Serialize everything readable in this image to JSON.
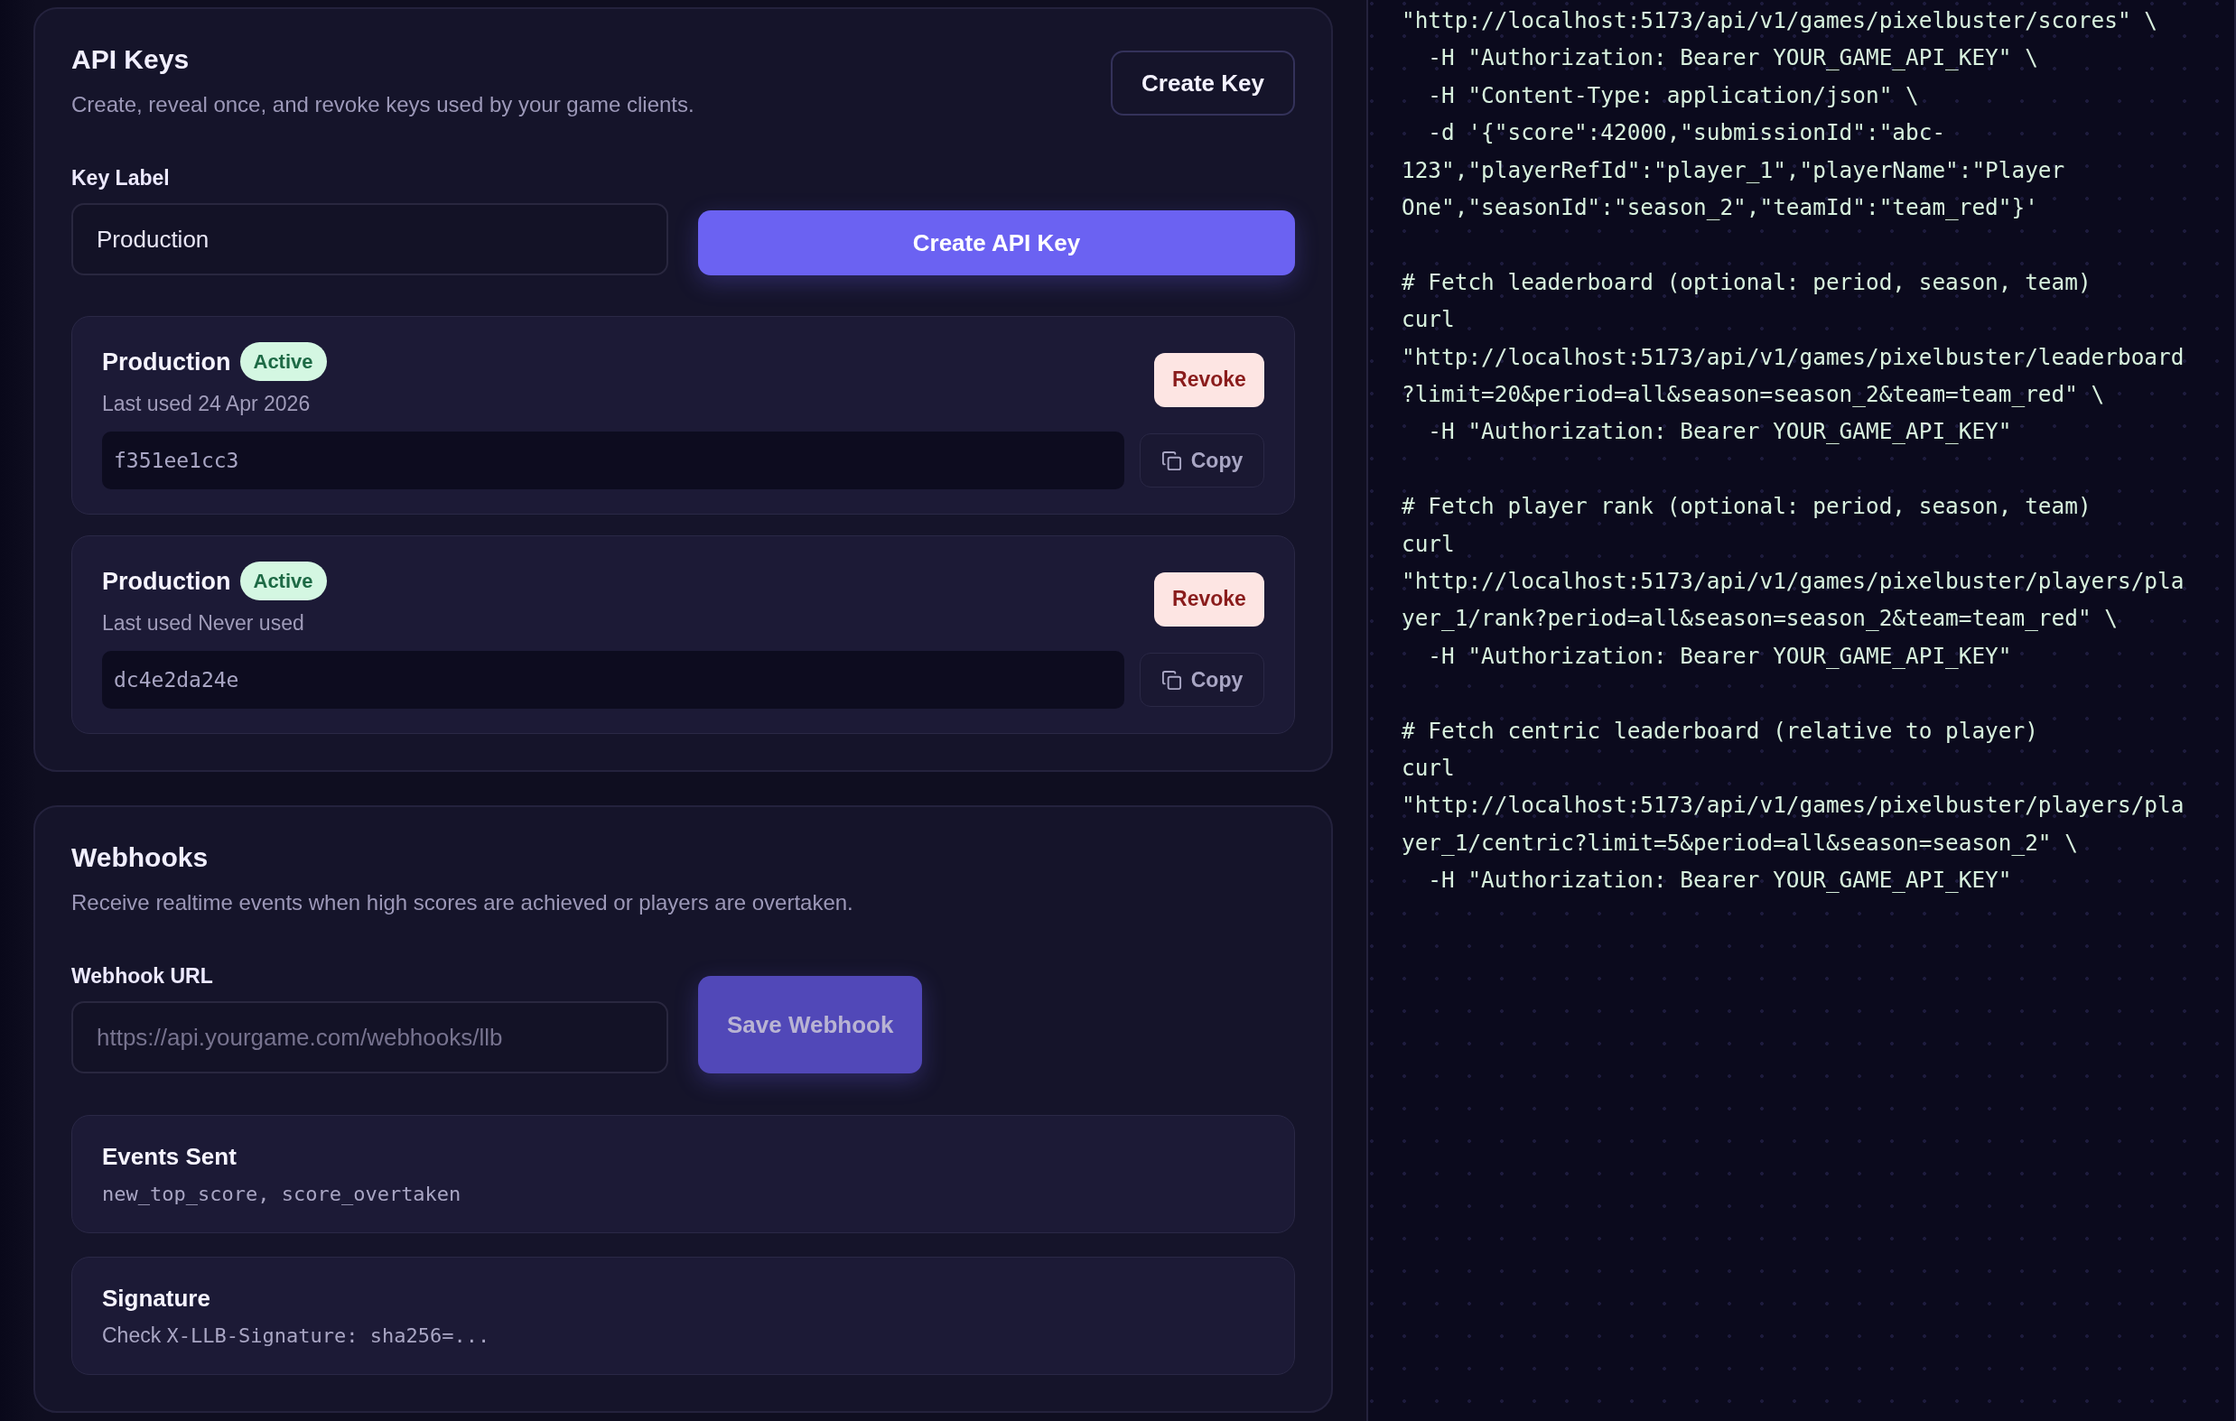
{
  "api_keys": {
    "title": "API Keys",
    "subtitle": "Create, reveal once, and revoke keys used by your game clients.",
    "create_button": "Create Key",
    "key_label": {
      "label": "Key Label",
      "value": "Production"
    },
    "create_api_key_button": "Create API Key",
    "keys": [
      {
        "name": "Production",
        "status": "Active",
        "last_used": "Last used 24 Apr 2026",
        "key": "f351ee1cc3",
        "revoke_button": "Revoke",
        "copy_button": "Copy"
      },
      {
        "name": "Production",
        "status": "Active",
        "last_used": "Last used Never used",
        "key": "dc4e2da24e",
        "revoke_button": "Revoke",
        "copy_button": "Copy"
      }
    ]
  },
  "webhooks": {
    "title": "Webhooks",
    "subtitle": "Receive realtime events when high scores are achieved or players are overtaken.",
    "url_field": {
      "label": "Webhook URL",
      "placeholder": "https://api.yourgame.com/webhooks/llb"
    },
    "save_button": {
      "label": "Save Webhook",
      "disabled": true
    },
    "info_cards": [
      {
        "title": "Events Sent",
        "code": "new_top_score, score_overtaken"
      },
      {
        "title": "Signature",
        "prefix": "Check",
        "code": "X-LLB-Signature: sha256=..."
      }
    ]
  },
  "code_sample": {
    "blocks": [
      {
        "lines": [
          "\"http://localhost:5173/api/v1/games/pixelbuster/scores\" \\",
          "  -H \"Authorization: Bearer YOUR_GAME_API_KEY\" \\",
          "  -H \"Content-Type: application/json\" \\",
          "  -d '{\"score\":42000,\"submissionId\":\"abc-",
          "123\",\"playerRefId\":\"player_1\",\"playerName\":\"Player",
          "One\",\"seasonId\":\"season_2\",\"teamId\":\"team_red\"}'"
        ]
      },
      {
        "lines": [
          "# Fetch leaderboard (optional: period, season, team)",
          "curl",
          "\"http://localhost:5173/api/v1/games/pixelbuster/leaderboard",
          "?limit=20&period=all&season=season_2&team=team_red\" \\",
          "  -H \"Authorization: Bearer YOUR_GAME_API_KEY\""
        ]
      },
      {
        "lines": [
          "# Fetch player rank (optional: period, season, team)",
          "curl",
          "\"http://localhost:5173/api/v1/games/pixelbuster/players/pla",
          "yer_1/rank?period=all&season=season_2&team=team_red\" \\",
          "  -H \"Authorization: Bearer YOUR_GAME_API_KEY\""
        ]
      },
      {
        "lines": [
          "# Fetch centric leaderboard (relative to player)",
          "curl",
          "\"http://localhost:5173/api/v1/games/pixelbuster/players/pla",
          "yer_1/centric?limit=5&period=all&season=season_2\" \\",
          "  -H \"Authorization: Bearer YOUR_GAME_API_KEY\""
        ]
      }
    ]
  }
}
